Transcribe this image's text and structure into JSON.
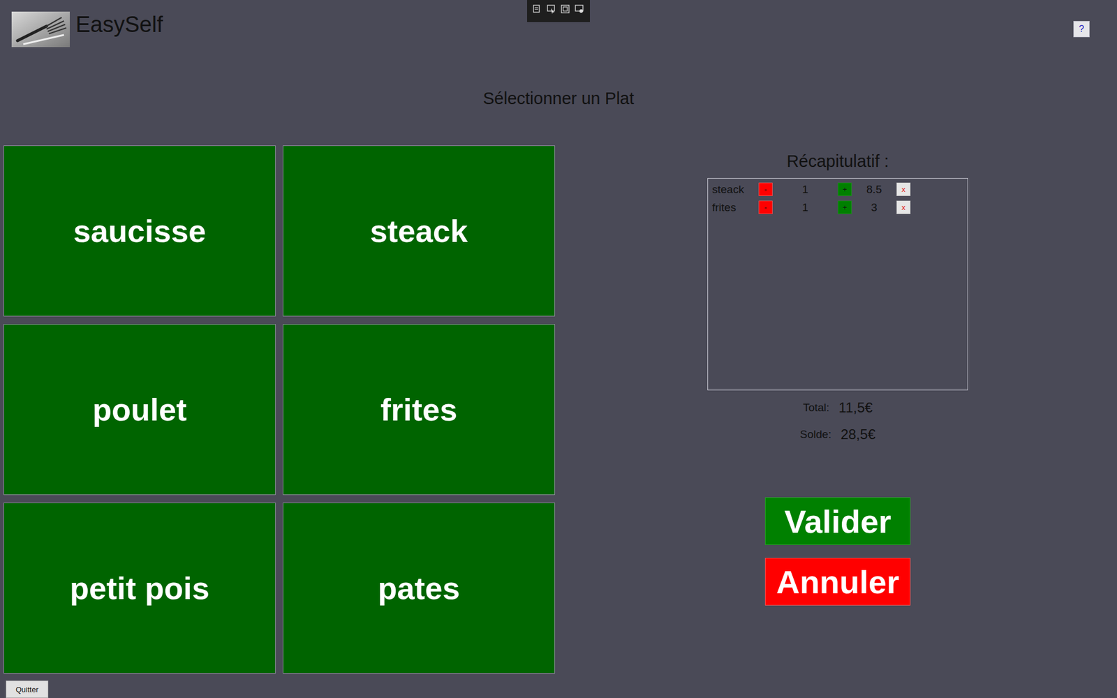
{
  "app": {
    "title": "EasySelf",
    "help": "?",
    "quit": "Quitter"
  },
  "heading": "Sélectionner un Plat",
  "dishes": [
    "saucisse",
    "steack",
    "poulet",
    "frites",
    "petit pois",
    "pates"
  ],
  "summary": {
    "title": "Récapitulatif :",
    "items": [
      {
        "name": "steack",
        "decrement": "-",
        "quantity": "1",
        "increment": "+",
        "price": "8.5",
        "remove": "x"
      },
      {
        "name": "frites",
        "decrement": "-",
        "quantity": "1",
        "increment": "+",
        "price": "3",
        "remove": "x"
      }
    ],
    "total_label": "Total:",
    "total": "11,5€",
    "balance_label": "Solde:",
    "balance": "28,5€"
  },
  "buttons": {
    "validate": "Valider",
    "cancel": "Annuler"
  }
}
